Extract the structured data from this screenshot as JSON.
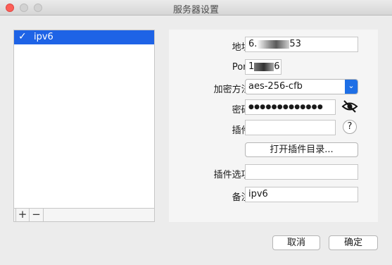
{
  "window": {
    "title": "服务器设置"
  },
  "server_list": {
    "items": [
      {
        "label": "ipv6",
        "checked": true
      }
    ],
    "add_label": "+",
    "remove_label": "−"
  },
  "form": {
    "address": {
      "label": "地址:",
      "value_prefix": "6.",
      "value_suffix": "53"
    },
    "port": {
      "label": "Port:",
      "value_prefix": "1",
      "value_suffix": "6"
    },
    "encryption": {
      "label": "加密方法:",
      "value": "aes-256-cfb"
    },
    "password": {
      "label": "密码:",
      "value": "●●●●●●●●●●●●●"
    },
    "plugin": {
      "label": "插件:",
      "value": "",
      "help": "?"
    },
    "open_plugin_dir": {
      "label": "打开插件目录..."
    },
    "plugin_options": {
      "label": "插件选项:",
      "value": ""
    },
    "remarks": {
      "label": "备注:",
      "value": "ipv6"
    }
  },
  "buttons": {
    "cancel": "取消",
    "ok": "确定"
  },
  "colors": {
    "selection": "#1e63e6",
    "close": "#fc5f57"
  }
}
